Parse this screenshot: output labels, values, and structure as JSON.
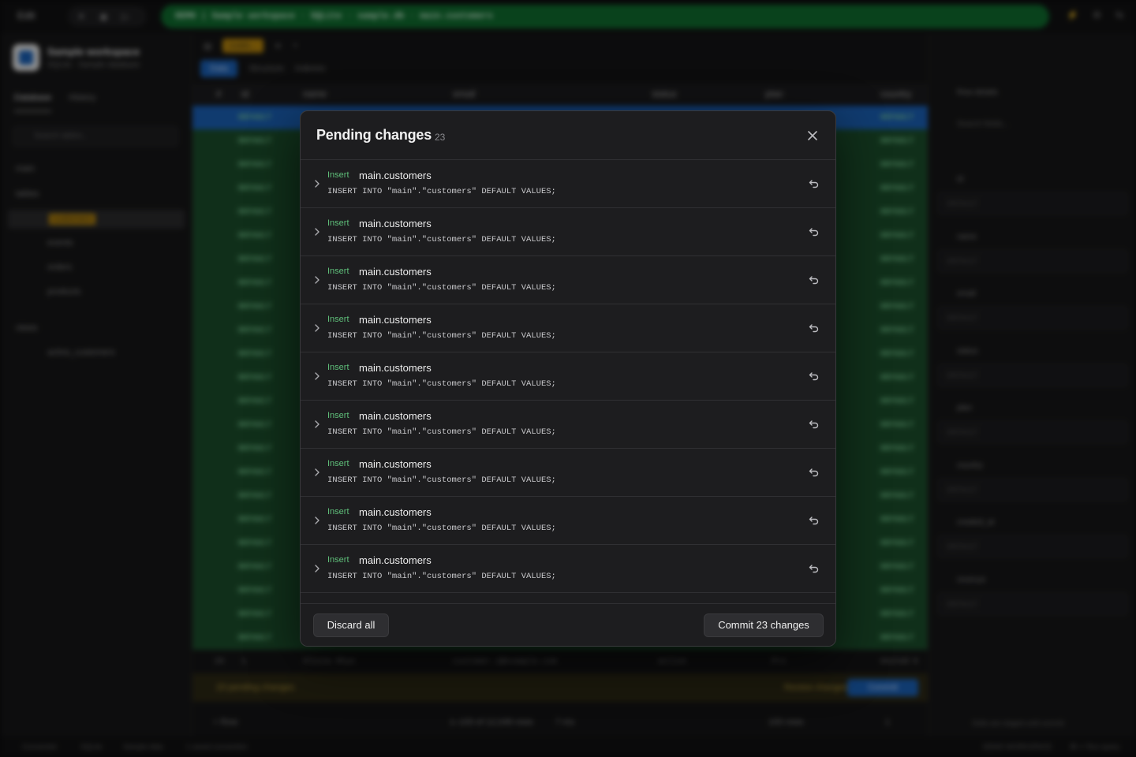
{
  "app": {
    "edit_label": "Edit",
    "breadcrumb": "DEMO | Sample workspace · SQLite · sample.db · main.customers",
    "workspace_name": "Sample workspace",
    "workspace_sub": "SQLite · Sample database",
    "sidebar_tabs": [
      "Database",
      "History"
    ],
    "search_tables_placeholder": "Search tables...",
    "schema": "main",
    "tables_header": "tables",
    "tables": [
      "customers",
      "events",
      "orders",
      "products"
    ],
    "views_header": "views",
    "views": [
      "active_customers"
    ],
    "tab_label": "custo...",
    "subtabs": [
      "Data",
      "Structure",
      "Indexes"
    ],
    "toolbar": [
      "Export",
      "Filters",
      "Columns"
    ],
    "columns": [
      "#",
      "id",
      "name",
      "email",
      "status",
      "plan",
      "country"
    ],
    "default_cell": "DEFAULT",
    "plain_row": {
      "num": "24",
      "id": "1",
      "name": "Olivia Rhye",
      "email": "customer.1@example.com",
      "status": "active",
      "plan": "Pro",
      "country": "United K"
    },
    "pending_bar": {
      "text": "23 pending changes",
      "review": "Review changes",
      "commit": "Commit"
    },
    "footer": {
      "add_row": "Row",
      "range": "1–100 of 12,048 rows",
      "time": "7 ms",
      "page_size": "100 rows",
      "page": "1"
    },
    "details": {
      "title": "Row details",
      "search": "Search fields...",
      "fields": [
        "id",
        "name",
        "email",
        "status",
        "plan",
        "country",
        "created_at",
        "revenue"
      ],
      "value": "DEFAULT",
      "note": "Edits are staged until commit"
    },
    "status": {
      "connected": "Connected",
      "engine": "SQLite",
      "data": "Sample data",
      "connections": "1 saved connection",
      "workspace": "DEMO WORKSPACE",
      "run": "⌘ ↵ Run query"
    }
  },
  "modal": {
    "title": "Pending changes",
    "count": "23",
    "items": [
      {
        "kind": "Insert",
        "table": "main.customers",
        "sql": "INSERT INTO \"main\".\"customers\" DEFAULT VALUES;"
      },
      {
        "kind": "Insert",
        "table": "main.customers",
        "sql": "INSERT INTO \"main\".\"customers\" DEFAULT VALUES;"
      },
      {
        "kind": "Insert",
        "table": "main.customers",
        "sql": "INSERT INTO \"main\".\"customers\" DEFAULT VALUES;"
      },
      {
        "kind": "Insert",
        "table": "main.customers",
        "sql": "INSERT INTO \"main\".\"customers\" DEFAULT VALUES;"
      },
      {
        "kind": "Insert",
        "table": "main.customers",
        "sql": "INSERT INTO \"main\".\"customers\" DEFAULT VALUES;"
      },
      {
        "kind": "Insert",
        "table": "main.customers",
        "sql": "INSERT INTO \"main\".\"customers\" DEFAULT VALUES;"
      },
      {
        "kind": "Insert",
        "table": "main.customers",
        "sql": "INSERT INTO \"main\".\"customers\" DEFAULT VALUES;"
      },
      {
        "kind": "Insert",
        "table": "main.customers",
        "sql": "INSERT INTO \"main\".\"customers\" DEFAULT VALUES;"
      },
      {
        "kind": "Insert",
        "table": "main.customers",
        "sql": "INSERT INTO \"main\".\"customers\" DEFAULT VALUES;"
      }
    ],
    "discard_label": "Discard all",
    "commit_label": "Commit 23 changes"
  },
  "colors": {
    "accent": "#1a5fb4",
    "insert_green": "#5fbf7a",
    "pending_row": "#1b4d2b",
    "title_pill": "#0f6b2e"
  },
  "icons": {
    "close": "close-icon",
    "expand": "chevron-right-icon",
    "undo": "undo-icon"
  }
}
